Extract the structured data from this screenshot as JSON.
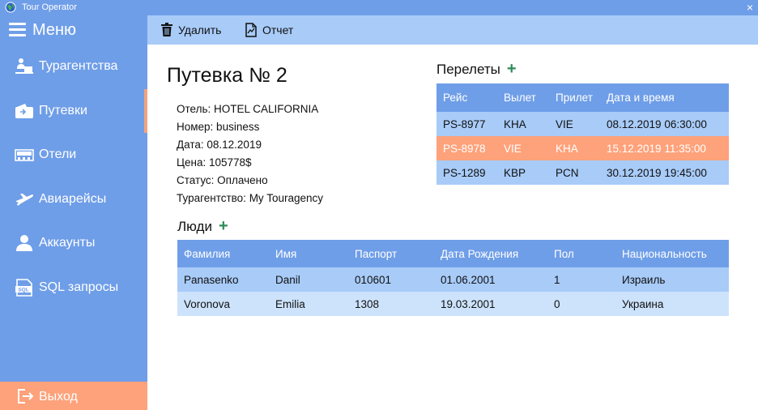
{
  "window": {
    "title": "Tour Operator",
    "close": "×"
  },
  "sidebar": {
    "menu_label": "Меню",
    "items": [
      {
        "label": "Турагентства",
        "icon": "agency-icon"
      },
      {
        "label": "Путевки",
        "icon": "voucher-icon",
        "active": true
      },
      {
        "label": "Отели",
        "icon": "hotel-icon"
      },
      {
        "label": "Авиарейсы",
        "icon": "airplane-icon"
      },
      {
        "label": "Аккаунты",
        "icon": "user-icon"
      },
      {
        "label": "SQL запросы",
        "icon": "sql-icon"
      }
    ],
    "logout_label": "Выход"
  },
  "toolbar": {
    "delete_label": "Удалить",
    "report_label": "Отчет"
  },
  "voucher": {
    "title": "Путевка № 2",
    "hotel": "Отель: HOTEL CALIFORNIA",
    "room": "Номер: business",
    "date": "Дата: 08.12.2019",
    "price": "Цена: 105778$",
    "status": "Статус: Оплачено",
    "agency": "Турагентство: My Touragency"
  },
  "flights": {
    "title": "Перелеты",
    "add": "+",
    "columns": [
      "Рейс",
      "Вылет",
      "Прилет",
      "Дата и время"
    ],
    "rows": [
      [
        "PS-8977",
        "KHA",
        "VIE",
        "08.12.2019 06:30:00"
      ],
      [
        "PS-8978",
        "VIE",
        "KHA",
        "15.12.2019 11:35:00"
      ],
      [
        "PS-1289",
        "KBP",
        "PCN",
        "30.12.2019 19:45:00"
      ]
    ]
  },
  "people": {
    "title": "Люди",
    "add": "+",
    "columns": [
      "Фамилия",
      "Имя",
      "Паспорт",
      "Дата Рождения",
      "Пол",
      "Национальность"
    ],
    "rows": [
      [
        "Panasenko",
        "Danil",
        "010601",
        "01.06.2001",
        "1",
        "Израиль"
      ],
      [
        "Voronova",
        "Emilia",
        "1308",
        "19.03.2001",
        "0",
        "Украина"
      ]
    ]
  },
  "colors": {
    "accent": "#6f9ee8",
    "toolbar": "#a8cbf8",
    "row_light": "#cde3fc",
    "selected": "#fda27b",
    "add_icon": "#2e8b57"
  }
}
